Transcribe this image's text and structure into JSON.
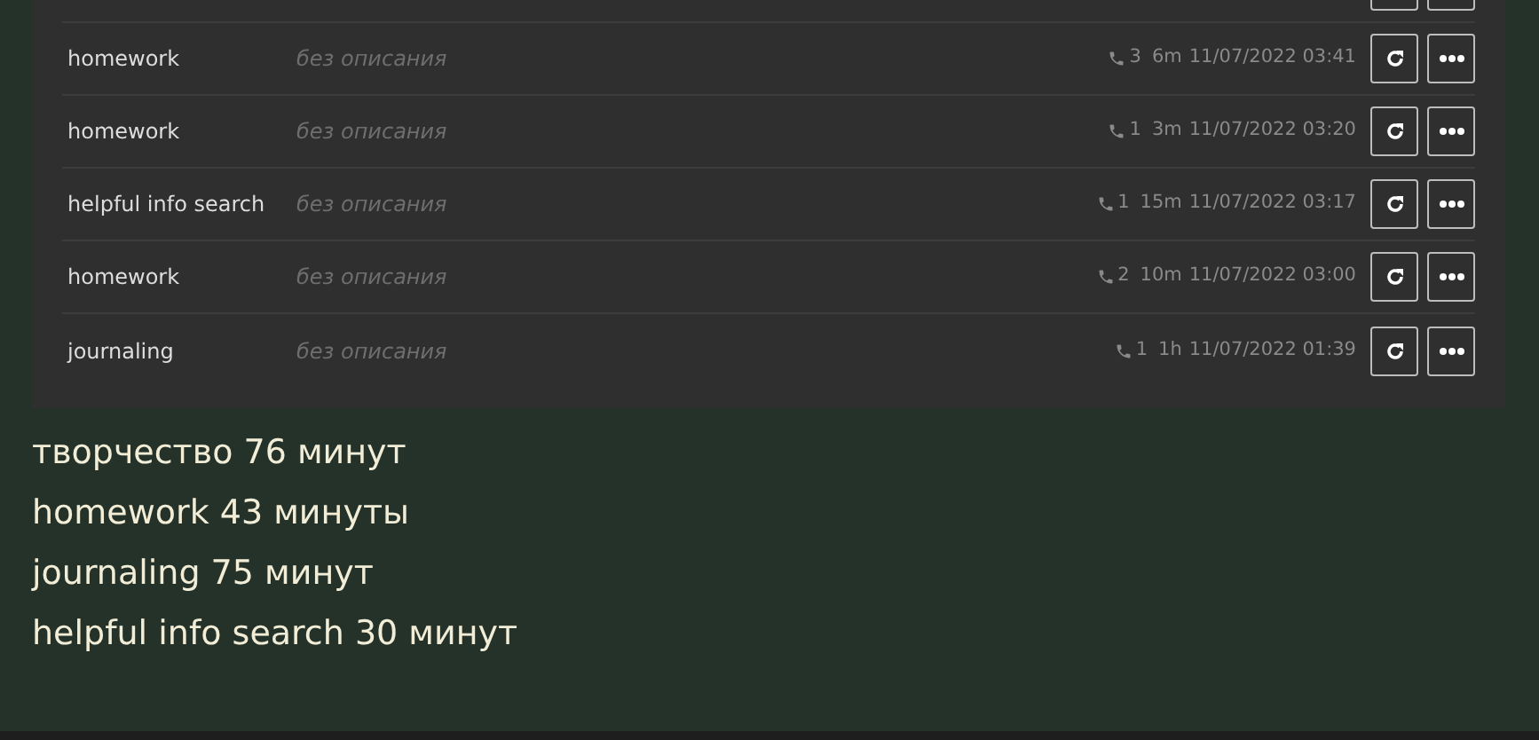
{
  "sessions": [
    {
      "name": "homework",
      "description": "без описания",
      "calls": "3",
      "duration": "6m",
      "date": "11/07/2022 03:41"
    },
    {
      "name": "homework",
      "description": "без описания",
      "calls": "1",
      "duration": "3m",
      "date": "11/07/2022 03:20"
    },
    {
      "name": "helpful info search",
      "description": "без описания",
      "calls": "1",
      "duration": "15m",
      "date": "11/07/2022 03:17"
    },
    {
      "name": "homework",
      "description": "без описания",
      "calls": "2",
      "duration": "10m",
      "date": "11/07/2022 03:00"
    },
    {
      "name": "journaling",
      "description": "без описания",
      "calls": "1",
      "duration": "1h",
      "date": "11/07/2022 01:39"
    }
  ],
  "totals": [
    "творчество 76 минут",
    "homework 43 минуты",
    "journaling 75 минут",
    "helpful info search 30 минут"
  ]
}
